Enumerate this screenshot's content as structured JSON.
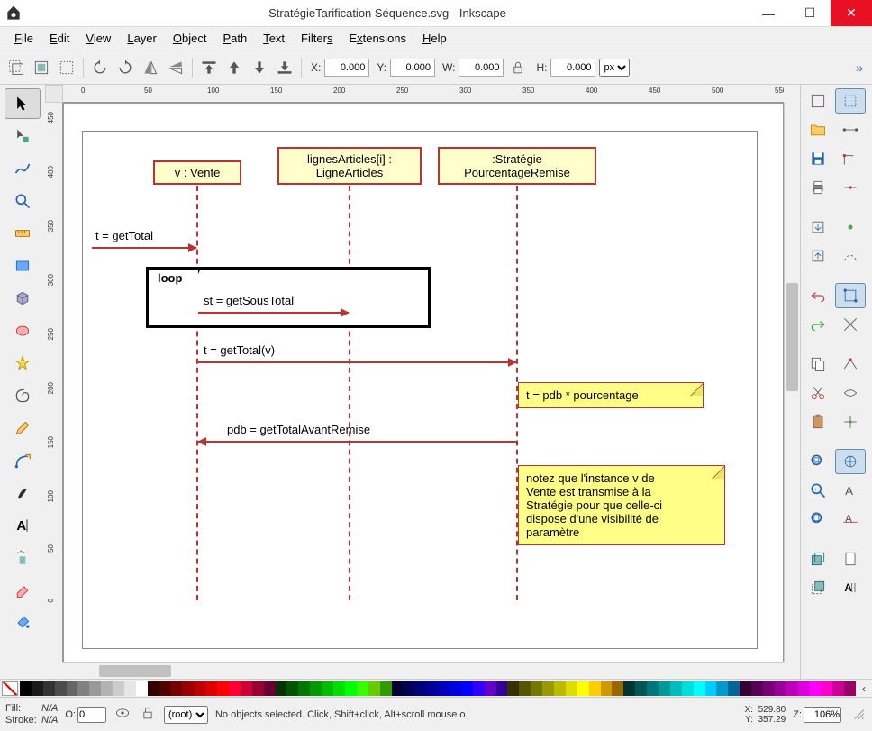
{
  "window": {
    "title": "StratégieTarification Séquence.svg - Inkscape"
  },
  "menu": [
    "File",
    "Edit",
    "View",
    "Layer",
    "Object",
    "Path",
    "Text",
    "Filters",
    "Extensions",
    "Help"
  ],
  "toolbar": {
    "x_label": "X:",
    "x_val": "0.000",
    "y_label": "Y:",
    "y_val": "0.000",
    "w_label": "W:",
    "w_val": "0.000",
    "h_label": "H:",
    "h_val": "0.000",
    "unit": "px"
  },
  "ruler_h": [
    "0",
    "50",
    "100",
    "150",
    "200",
    "250",
    "300",
    "350",
    "400",
    "450",
    "500",
    "550"
  ],
  "ruler_v": [
    "450",
    "400",
    "350",
    "300",
    "250",
    "200",
    "150",
    "100",
    "50",
    "0"
  ],
  "uml": {
    "box1": "v : Vente",
    "box2_l1": "lignesArticles[i] :",
    "box2_l2": "LigneArticles",
    "box3_l1": ":Stratégie",
    "box3_l2": "PourcentageRemise",
    "msg1": "t = getTotal",
    "loop_label": "loop",
    "msg2": "st = getSousTotal",
    "msg3": "t = getTotal(v)",
    "note1": "t = pdb * pourcentage",
    "msg4": "pdb = getTotalAvantRemise",
    "note2_l1": "notez que l'instance v de",
    "note2_l2": "Vente est transmise à la",
    "note2_l3": "Stratégie pour que celle-ci",
    "note2_l4": "dispose d'une visibilité de",
    "note2_l5": "paramètre"
  },
  "status": {
    "fill_label": "Fill:",
    "fill_val": "N/A",
    "stroke_label": "Stroke:",
    "stroke_val": "N/A",
    "o_label": "O:",
    "o_val": "0",
    "layer": "(root)",
    "hint": "No objects selected. Click, Shift+click, Alt+scroll mouse o",
    "xc_label": "X:",
    "xc_val": "529.80",
    "yc_label": "Y:",
    "yc_val": "357.29",
    "z_label": "Z:",
    "z_val": "106%"
  },
  "palette": [
    "#000000",
    "#1a1a1a",
    "#333333",
    "#4d4d4d",
    "#666666",
    "#808080",
    "#999999",
    "#b3b3b3",
    "#cccccc",
    "#e6e6e6",
    "#ffffff",
    "#330000",
    "#550000",
    "#770000",
    "#990000",
    "#bb0000",
    "#dd0000",
    "#ff0000",
    "#ff0033",
    "#cc0033",
    "#990033",
    "#660033",
    "#003300",
    "#005500",
    "#007700",
    "#009900",
    "#00bb00",
    "#00dd00",
    "#00ff00",
    "#33ff00",
    "#66cc00",
    "#339900",
    "#000033",
    "#000055",
    "#000077",
    "#000099",
    "#0000bb",
    "#0000dd",
    "#0000ff",
    "#3300ff",
    "#6600cc",
    "#330099",
    "#333300",
    "#555500",
    "#777700",
    "#999900",
    "#bbbb00",
    "#dddd00",
    "#ffff00",
    "#ffcc00",
    "#cc9900",
    "#996600",
    "#003333",
    "#005555",
    "#007777",
    "#009999",
    "#00bbbb",
    "#00dddd",
    "#00ffff",
    "#00ccff",
    "#0099cc",
    "#006699",
    "#330033",
    "#550055",
    "#770077",
    "#990099",
    "#bb00bb",
    "#dd00dd",
    "#ff00ff",
    "#ff00cc",
    "#cc0099",
    "#990066"
  ]
}
